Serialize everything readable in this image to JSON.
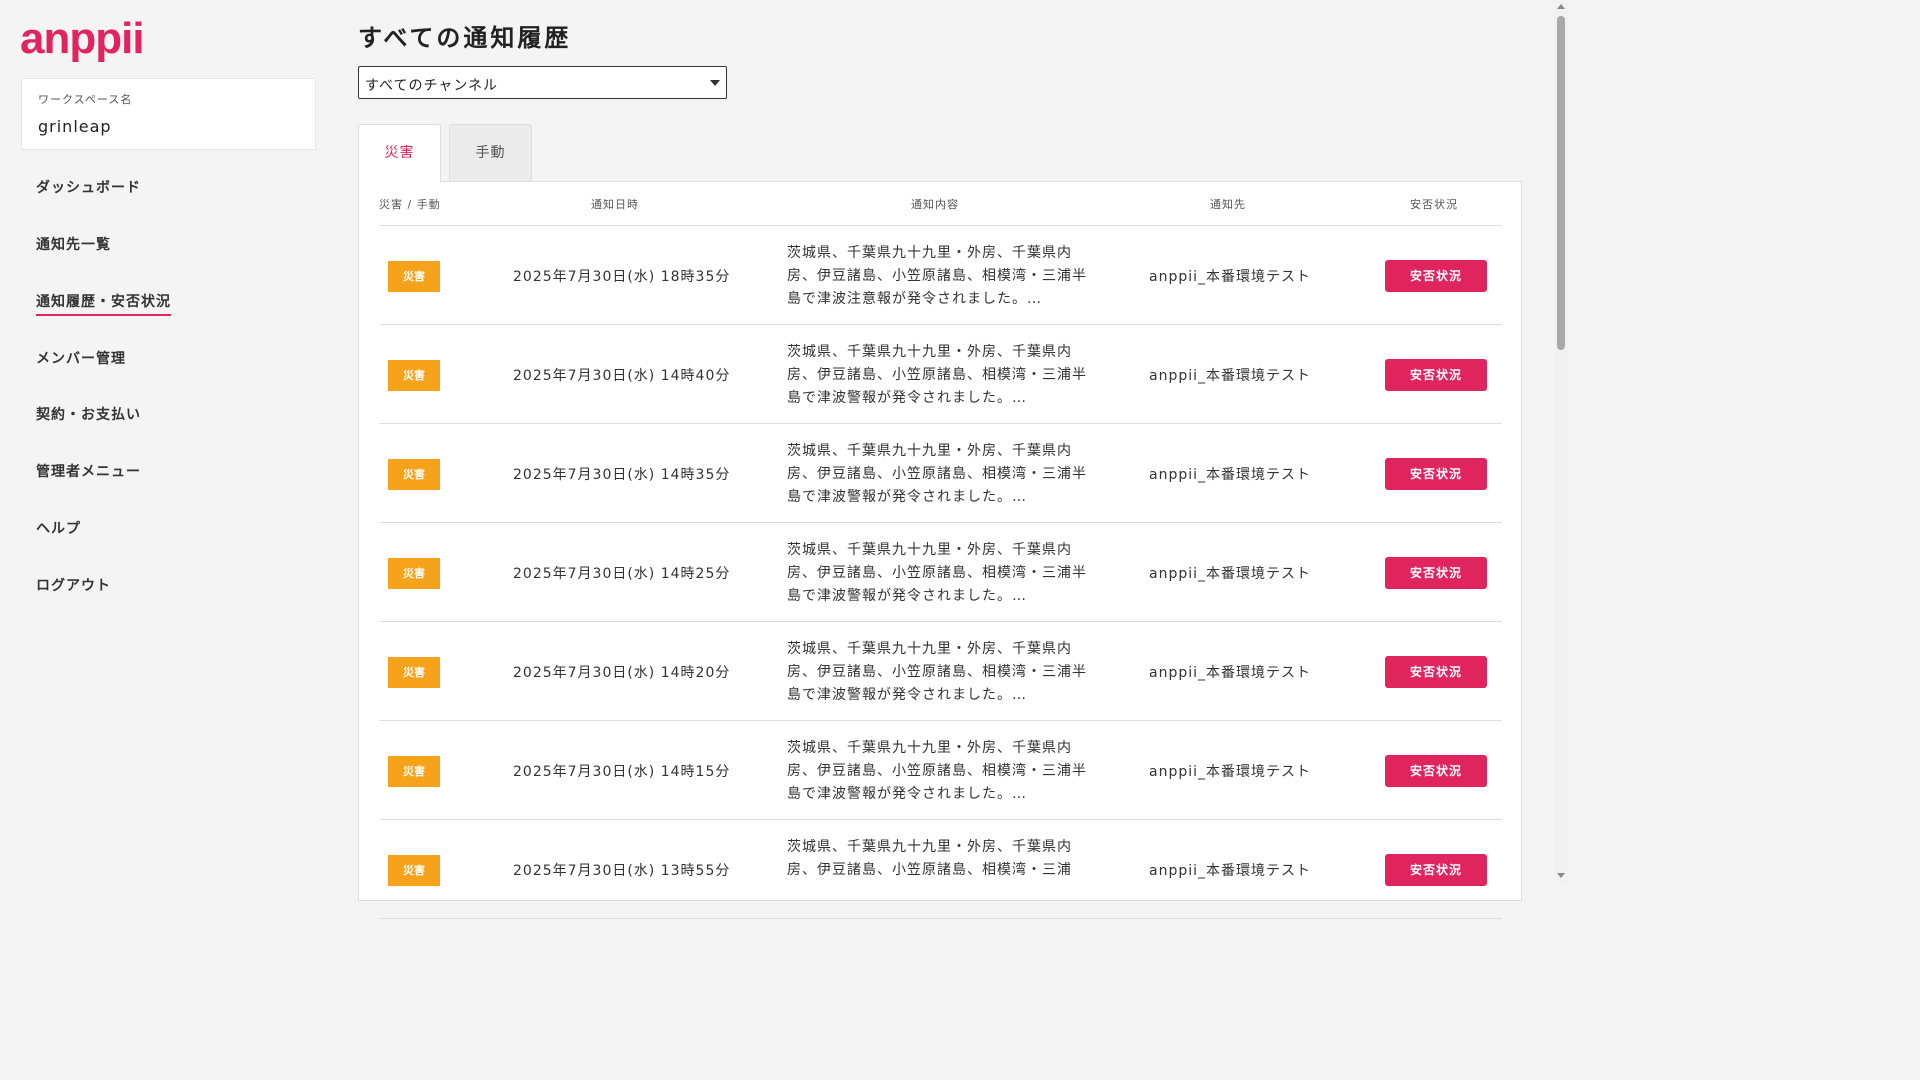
{
  "app": {
    "logo": "anppii"
  },
  "workspace": {
    "label": "ワークスペース名",
    "name": "grinleap"
  },
  "sidebar": {
    "items": [
      {
        "label": "ダッシュボード"
      },
      {
        "label": "通知先一覧"
      },
      {
        "label": "通知履歴・安否状況"
      },
      {
        "label": "メンバー管理"
      },
      {
        "label": "契約・お支払い"
      },
      {
        "label": "管理者メニュー"
      },
      {
        "label": "ヘルプ"
      },
      {
        "label": "ログアウト"
      }
    ]
  },
  "main": {
    "title": "すべての通知履歴",
    "channel_select": {
      "value": "すべてのチャンネル"
    },
    "tabs": [
      {
        "label": "災害"
      },
      {
        "label": "手動"
      }
    ],
    "table": {
      "headers": {
        "type": "災害 / 手動",
        "datetime": "通知日時",
        "content": "通知内容",
        "destination": "通知先",
        "status": "安否状況"
      },
      "rows": [
        {
          "type": "災害",
          "datetime": "2025年7月30日(水) 18時35分",
          "content": "茨城県、千葉県九十九里・外房、千葉県内房、伊豆諸島、小笠原諸島、相模湾・三浦半島で津波注意報が発令されました。…",
          "destination": "anppii_本番環境テスト",
          "status_button": "安否状況"
        },
        {
          "type": "災害",
          "datetime": "2025年7月30日(水) 14時40分",
          "content": "茨城県、千葉県九十九里・外房、千葉県内房、伊豆諸島、小笠原諸島、相模湾・三浦半島で津波警報が発令されました。…",
          "destination": "anppii_本番環境テスト",
          "status_button": "安否状況"
        },
        {
          "type": "災害",
          "datetime": "2025年7月30日(水) 14時35分",
          "content": "茨城県、千葉県九十九里・外房、千葉県内房、伊豆諸島、小笠原諸島、相模湾・三浦半島で津波警報が発令されました。…",
          "destination": "anppii_本番環境テスト",
          "status_button": "安否状況"
        },
        {
          "type": "災害",
          "datetime": "2025年7月30日(水) 14時25分",
          "content": "茨城県、千葉県九十九里・外房、千葉県内房、伊豆諸島、小笠原諸島、相模湾・三浦半島で津波警報が発令されました。…",
          "destination": "anppii_本番環境テスト",
          "status_button": "安否状況"
        },
        {
          "type": "災害",
          "datetime": "2025年7月30日(水) 14時20分",
          "content": "茨城県、千葉県九十九里・外房、千葉県内房、伊豆諸島、小笠原諸島、相模湾・三浦半島で津波警報が発令されました。…",
          "destination": "anppii_本番環境テスト",
          "status_button": "安否状況"
        },
        {
          "type": "災害",
          "datetime": "2025年7月30日(水) 14時15分",
          "content": "茨城県、千葉県九十九里・外房、千葉県内房、伊豆諸島、小笠原諸島、相模湾・三浦半島で津波警報が発令されました。…",
          "destination": "anppii_本番環境テスト",
          "status_button": "安否状況"
        },
        {
          "type": "災害",
          "datetime": "2025年7月30日(水) 13時55分",
          "content": "茨城県、千葉県九十九里・外房、千葉県内房、伊豆諸島、小笠原諸島、相模湾・三浦",
          "destination": "anppii_本番環境テスト",
          "status_button": "安否状況"
        }
      ]
    }
  },
  "colors": {
    "accent": "#e0245e",
    "badge": "#f7a21b"
  }
}
